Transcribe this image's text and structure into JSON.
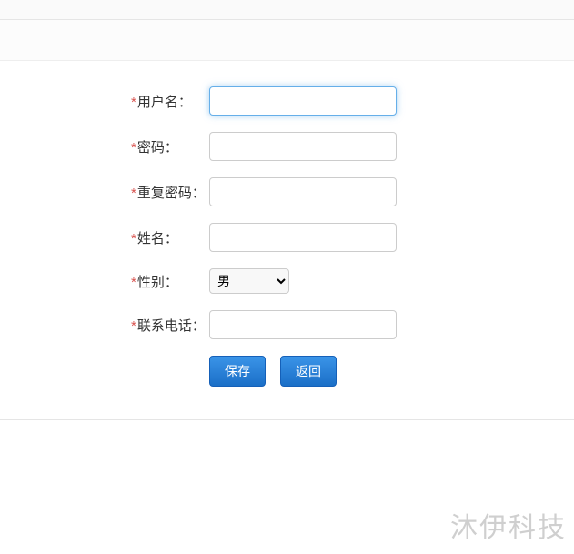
{
  "form": {
    "fields": {
      "username": {
        "label": "用户名：",
        "value": ""
      },
      "password": {
        "label": "密码：",
        "value": ""
      },
      "password_confirm": {
        "label": "重复密码：",
        "value": ""
      },
      "name": {
        "label": "姓名：",
        "value": ""
      },
      "gender": {
        "label": "性别：",
        "selected": "男"
      },
      "phone": {
        "label": "联系电话：",
        "value": ""
      }
    },
    "required_mark": "*",
    "buttons": {
      "save": "保存",
      "back": "返回"
    }
  },
  "watermark": "沐伊科技"
}
